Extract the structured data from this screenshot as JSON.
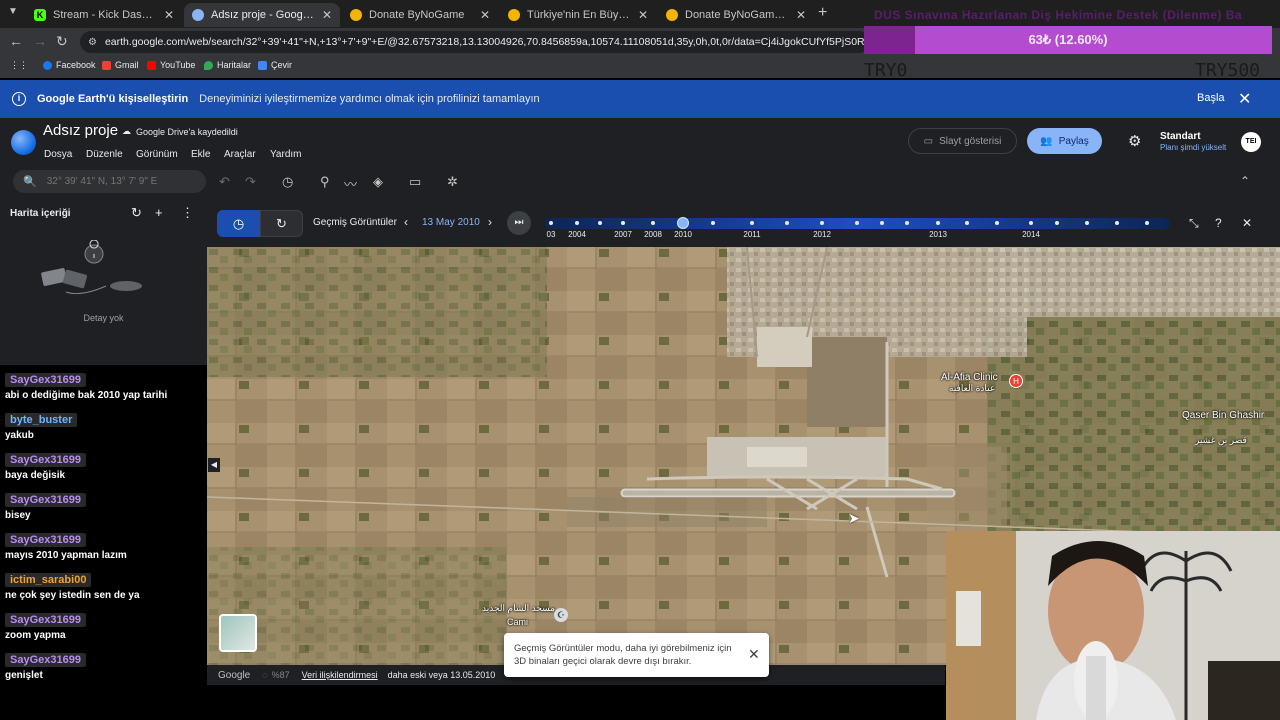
{
  "browser": {
    "tabs": [
      {
        "label": "Stream - Kick Dashboard",
        "fav_color": "#53fc18",
        "fav_glyph": "K"
      },
      {
        "label": "Adsız proje - Google Earth",
        "fav_color": "#8ab4f8",
        "fav_glyph": ""
      },
      {
        "label": "Donate ByNoGame",
        "fav_color": "#f4b400",
        "fav_glyph": ""
      },
      {
        "label": "Türkiye'nin En Büyük Oyuncu D",
        "fav_color": "#f4b400",
        "fav_glyph": ""
      },
      {
        "label": "Donate ByNoGame - Gelen/Gid",
        "fav_color": "#f4b400",
        "fav_glyph": ""
      }
    ],
    "url": "earth.google.com/web/search/32°+39'+41\"+N,+13°+7'+9\"+E/@32.67573218,13.13004926,70.8456859a,10574.11108051d,35y,0h,0t,0r/data=Cj4iJgokCUfYf5PjS0RAEZbbQx_YRERAGU4e1",
    "bookmarks": [
      "Facebook",
      "Gmail",
      "YouTube",
      "Haritalar",
      "Çevir"
    ]
  },
  "donation": {
    "title": "DUS Sınavına Hazırlanan Diş Hekimine Destek (Dilenme) Ba",
    "amount_text": "63₺ (12.60%)",
    "progress": 0.126,
    "min_label": "TRY0",
    "max_label": "TRY500"
  },
  "banner": {
    "title": "Google Earth'ü kişiselleştirin",
    "desc": "Deneyiminizi iyileştirmemize yardımcı olmak için profilinizi tamamlayın",
    "action": "Başla"
  },
  "earth": {
    "project_title": "Adsız proje",
    "drive_status": "Google Drive'a kaydedildi",
    "menu": [
      "Dosya",
      "Düzenle",
      "Görünüm",
      "Ekle",
      "Araçlar",
      "Yardım"
    ],
    "slideshow": "Slayt gösterisi",
    "share": "Paylaş",
    "plan_title": "Standart",
    "plan_sub": "Planı şimdi yükselt",
    "avatar": "TEI",
    "search_placeholder": "32° 39' 41\" N, 13° 7' 9\" E"
  },
  "left_panel": {
    "title": "Harita içeriği",
    "empty": "Detay yok"
  },
  "timeline": {
    "label": "Geçmiş Görüntüler",
    "date": "13 May 2010",
    "years": [
      "03",
      "2004",
      "2007",
      "2008",
      "2010",
      "2011",
      "2012",
      "2013",
      "2014"
    ],
    "selected_year": "2010"
  },
  "map": {
    "places": [
      {
        "name": "Al-Afia Clinic",
        "sub": "عيادة العافية"
      },
      {
        "name": "Qaser Bin Ghashir",
        "sub": "قصر بن غشير"
      },
      {
        "name": "مسجد الشام الجديد",
        "sub": "Cami"
      }
    ],
    "footer": {
      "brand": "Google",
      "zoom": "%87",
      "terms": "Veri ilişkilendirmesi",
      "imagery_date": "daha eski veya 13.05.2010"
    },
    "toast": "Geçmiş Görüntüler modu, daha iyi görebilmeniz için 3D binaları geçici olarak devre dışı bırakır."
  },
  "chat": [
    {
      "user": "SayGex31699",
      "text": "abi o dediğime bak 2010 yap tarihi",
      "color": "purple"
    },
    {
      "user": "byte_buster",
      "text": "yakub",
      "color": "blue"
    },
    {
      "user": "SayGex31699",
      "text": "baya değisik",
      "color": "purple"
    },
    {
      "user": "SayGex31699",
      "text": "bisey",
      "color": "purple"
    },
    {
      "user": "SayGex31699",
      "text": "mayıs 2010 yapman lazım",
      "color": "purple"
    },
    {
      "user": "ictim_sarabi00",
      "text": "ne çok şey istedin sen de ya",
      "color": "orange"
    },
    {
      "user": "SayGex31699",
      "text": "zoom yapma",
      "color": "purple"
    },
    {
      "user": "SayGex31699",
      "text": "genişlet",
      "color": "purple"
    }
  ]
}
